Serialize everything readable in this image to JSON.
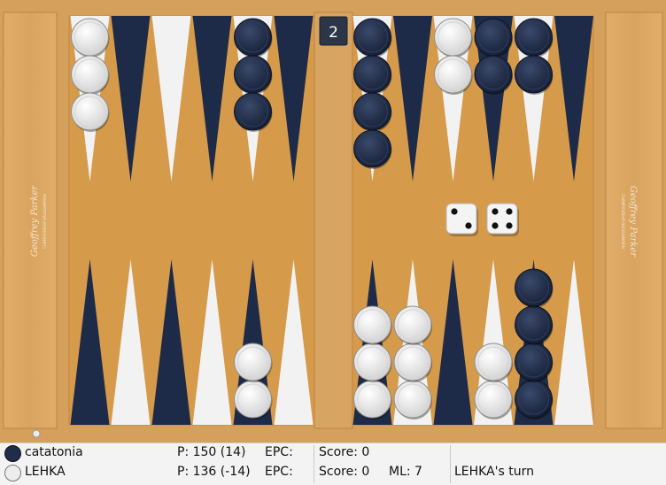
{
  "cube_value": "2",
  "dice": [
    2,
    4
  ],
  "board_brand": "Geoffrey Parker",
  "board_brand_sub": "CHAMPIONSHIP BACKGAMMON",
  "colors": {
    "dark_checker": "#1f2d4a",
    "light_checker": "#ededed",
    "dark_point": "#1e2b48",
    "light_point": "#f2f2f2",
    "felt": "#d69a4b",
    "frame": "#dca862"
  },
  "positions": {
    "top": [
      {
        "color": "light",
        "count": 3
      },
      {
        "color": null,
        "count": 0
      },
      {
        "color": null,
        "count": 0
      },
      {
        "color": null,
        "count": 0
      },
      {
        "color": "dark",
        "count": 3
      },
      {
        "color": null,
        "count": 0
      },
      {
        "color": "dark",
        "count": 4
      },
      {
        "color": null,
        "count": 0
      },
      {
        "color": "light",
        "count": 2
      },
      {
        "color": "dark",
        "count": 2
      },
      {
        "color": "dark",
        "count": 2
      },
      {
        "color": null,
        "count": 0
      }
    ],
    "bottom": [
      {
        "color": null,
        "count": 0
      },
      {
        "color": null,
        "count": 0
      },
      {
        "color": null,
        "count": 0
      },
      {
        "color": null,
        "count": 0
      },
      {
        "color": "light",
        "count": 2
      },
      {
        "color": null,
        "count": 0
      },
      {
        "color": "light",
        "count": 3
      },
      {
        "color": "light",
        "count": 3
      },
      {
        "color": null,
        "count": 0
      },
      {
        "color": "light",
        "count": 2
      },
      {
        "color": "dark",
        "count": 4
      },
      {
        "color": null,
        "count": 0
      }
    ]
  },
  "players": [
    {
      "name": "catatonia",
      "pips": "P: 150 (14)",
      "epc": "EPC:",
      "score": "Score: 0",
      "color": "dark"
    },
    {
      "name": "LEHKA",
      "pips": "P: 136 (-14)",
      "epc": "EPC:",
      "score": "Score: 0",
      "color": "light"
    }
  ],
  "match_length": "ML: 7",
  "turn": "LEHKA's turn"
}
